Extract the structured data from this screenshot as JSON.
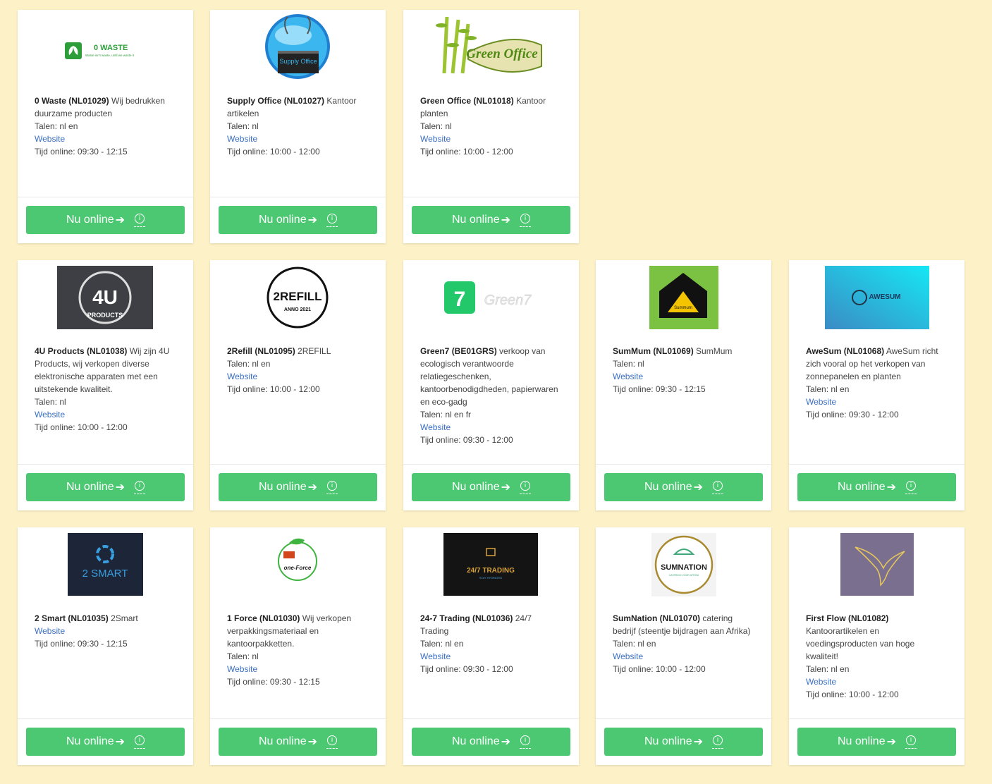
{
  "button_label": "Nu online",
  "cards": [
    {
      "name": "0 Waste (NL01029)",
      "desc": "Wij bedrukken duurzame producten",
      "talen": "Talen: nl en",
      "website": "Website",
      "tijd": "Tijd online: 09:30 - 12:15",
      "logo_text": "0 WASTE",
      "logo_sub": "Waste isn't waste, until we waste it"
    },
    {
      "name": "Supply Office (NL01027)",
      "desc": "Kantoor artikelen",
      "talen": "Talen: nl",
      "website": "Website",
      "tijd": "Tijd online: 10:00 - 12:00",
      "logo_text": "Supply Office"
    },
    {
      "name": "Green Office (NL01018)",
      "desc": "Kantoor planten",
      "talen": "Talen: nl",
      "website": "Website",
      "tijd": "Tijd online: 10:00 - 12:00",
      "logo_text": "Green Office"
    },
    {
      "name": "4U Products (NL01038)",
      "desc": "Wij zijn 4U Products, wij verkopen diverse elektronische apparaten met een uitstekende kwaliteit.",
      "talen": "Talen: nl",
      "website": "Website",
      "tijd": "Tijd online: 10:00 - 12:00",
      "logo_text": "4U",
      "logo_sub": "PRODUCTS"
    },
    {
      "name": "2Refill (NL01095)",
      "desc": "2REFILL",
      "talen": "Talen: nl en",
      "website": "Website",
      "tijd": "Tijd online: 10:00 - 12:00",
      "logo_text": "2REFILL",
      "logo_sub": "ANNO 2021"
    },
    {
      "name": "Green7 (BE01GRS)",
      "desc": "verkoop van ecologisch verantwoorde relatiegeschenken, kantoorbenodigdheden, papierwaren en eco-gadg",
      "talen": "Talen: nl en fr",
      "website": "Website",
      "tijd": "Tijd online: 09:30 - 12:00",
      "logo_text": "Green7"
    },
    {
      "name": "SumMum (NL01069)",
      "desc": "SumMum",
      "talen": "Talen: nl",
      "website": "Website",
      "tijd": "Tijd online: 09:30 - 12:15",
      "logo_text": "Summum"
    },
    {
      "name": "AweSum (NL01068)",
      "desc": "AweSum richt zich vooral op het verkopen van zonnepanelen en planten",
      "talen": "Talen: nl en",
      "website": "Website",
      "tijd": "Tijd online: 09:30 - 12:00",
      "logo_text": "AWESUM"
    },
    {
      "name": "2 Smart (NL01035)",
      "desc": "2Smart",
      "talen": "",
      "website": "Website",
      "tijd": "Tijd online: 09:30 - 12:15",
      "logo_text": "2 SMART"
    },
    {
      "name": "1 Force (NL01030)",
      "desc": "Wij verkopen verpakkingsmateriaal en kantoorpakketten.",
      "talen": "Talen: nl",
      "website": "Website",
      "tijd": "Tijd online: 09:30 - 12:15",
      "logo_text": "one-Force"
    },
    {
      "name": "24-7 Trading (NL01036)",
      "desc": "24/7 Trading",
      "talen": "Talen: nl en",
      "website": "Website",
      "tijd": "Tijd online: 09:30 - 12:00",
      "logo_text": "24/7 TRADING",
      "logo_sub": "STAY HYDRATED"
    },
    {
      "name": "SumNation (NL01070)",
      "desc": "catering bedrijf (steentje bijdragen aan Afrika)",
      "talen": "Talen: nl en",
      "website": "Website",
      "tijd": "Tijd online: 10:00 - 12:00",
      "logo_text": "SUMNATION",
      "logo_sub": "CATERING VOOR AFRIKA"
    },
    {
      "name": "First Flow (NL01082)",
      "desc": "Kantoorartikelen en voedingsproducten van hoge kwaliteit!",
      "talen": "Talen: nl en",
      "website": "Website",
      "tijd": "Tijd online: 10:00 - 12:00",
      "logo_text": ""
    }
  ]
}
